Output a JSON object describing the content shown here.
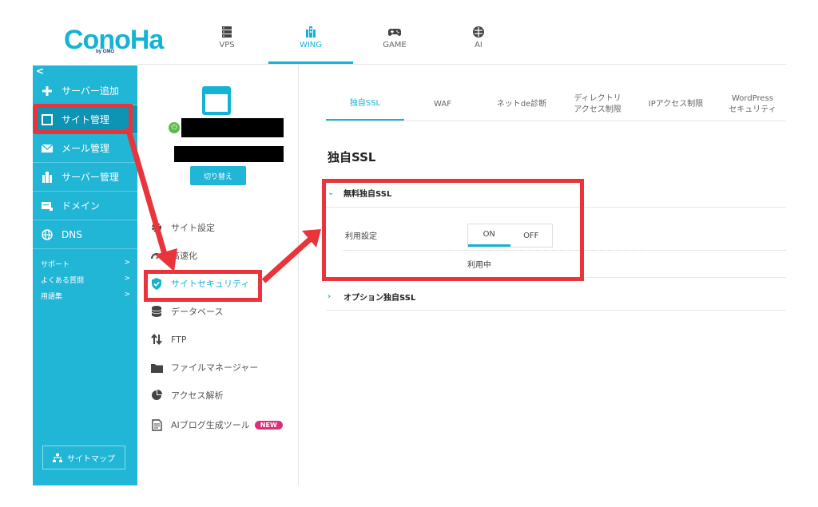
{
  "header": {
    "logo_text": "ConoHa",
    "logo_sub": "by GMO",
    "nav": [
      {
        "label": "VPS",
        "icon": "server-icon"
      },
      {
        "label": "WING",
        "icon": "wing-icon"
      },
      {
        "label": "GAME",
        "icon": "gamepad-icon"
      },
      {
        "label": "AI",
        "icon": "ai-chip-icon"
      }
    ]
  },
  "sidebar": {
    "collapse": "<",
    "items": [
      {
        "label": "サーバー追加",
        "icon": "plus-icon"
      },
      {
        "label": "サイト管理",
        "icon": "window-icon"
      },
      {
        "label": "メール管理",
        "icon": "mail-icon"
      },
      {
        "label": "サーバー管理",
        "icon": "server-manage-icon"
      },
      {
        "label": "ドメイン",
        "icon": "domain-icon"
      },
      {
        "label": "DNS",
        "icon": "globe-icon"
      }
    ],
    "links": [
      {
        "label": "サポート",
        "arrow": ">"
      },
      {
        "label": "よくある質問",
        "arrow": ">"
      },
      {
        "label": "用語集",
        "arrow": ">"
      }
    ],
    "sitemap": "サイトマップ"
  },
  "site_panel": {
    "switch_button": "切り替え",
    "menu": [
      {
        "label": "サイト設定",
        "icon": "settings-icon"
      },
      {
        "label": "高速化",
        "icon": "speed-icon"
      },
      {
        "label": "サイトセキュリティ",
        "icon": "shield-icon"
      },
      {
        "label": "データベース",
        "icon": "database-icon"
      },
      {
        "label": "FTP",
        "icon": "ftp-icon"
      },
      {
        "label": "ファイルマネージャー",
        "icon": "folder-icon"
      },
      {
        "label": "アクセス解析",
        "icon": "pie-chart-icon"
      },
      {
        "label": "AIブログ生成ツール",
        "icon": "document-icon",
        "badge": "NEW"
      }
    ]
  },
  "main": {
    "tabs": [
      {
        "label": "独自SSL"
      },
      {
        "label": "WAF"
      },
      {
        "label": "ネットde診断"
      },
      {
        "label": "ディレクトリ\nアクセス制限"
      },
      {
        "label": "IPアクセス制限"
      },
      {
        "label": "WordPress\nセキュリティ"
      }
    ],
    "title": "独自SSL",
    "free_ssl": {
      "heading": "無料独自SSL",
      "setting_label": "利用設定",
      "toggle_on": "ON",
      "toggle_off": "OFF",
      "status": "利用中"
    },
    "option_ssl": {
      "heading": "オプション独自SSL"
    }
  },
  "colors": {
    "accent": "#15b3d3",
    "sidebar": "#22b6d6",
    "annotation": "#e8343a",
    "badge": "#d8317b"
  }
}
